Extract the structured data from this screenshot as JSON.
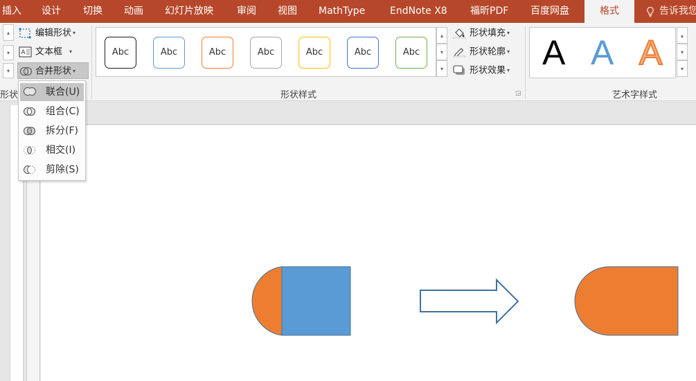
{
  "tabs": [
    {
      "label": "插入",
      "active": false
    },
    {
      "label": "设计",
      "active": false
    },
    {
      "label": "切换",
      "active": false
    },
    {
      "label": "动画",
      "active": false
    },
    {
      "label": "幻灯片放映",
      "active": false
    },
    {
      "label": "审阅",
      "active": false
    },
    {
      "label": "视图",
      "active": false
    },
    {
      "label": "MathType",
      "active": false
    },
    {
      "label": "EndNote X8",
      "active": false
    },
    {
      "label": "福昕PDF",
      "active": false
    },
    {
      "label": "百度网盘",
      "active": false
    },
    {
      "label": "格式",
      "active": true
    }
  ],
  "tell_me": {
    "label": "告诉我您",
    "icon": "lightbulb-icon"
  },
  "ribbon": {
    "insert_shapes": {
      "edit_shape": "编辑形状",
      "text_box": "文本框",
      "merge_shapes": "合并形状",
      "group_label_partial": "形状"
    },
    "shape_styles": {
      "group_label": "形状样式",
      "gallery": [
        {
          "text": "Abc",
          "border": "#1a1a1a"
        },
        {
          "text": "Abc",
          "border": "#5b9bd5"
        },
        {
          "text": "Abc",
          "border": "#ed7d31"
        },
        {
          "text": "Abc",
          "border": "#a5a5a5"
        },
        {
          "text": "Abc",
          "border": "#ffc000"
        },
        {
          "text": "Abc",
          "border": "#4472c4"
        },
        {
          "text": "Abc",
          "border": "#70ad47"
        }
      ],
      "fill": "形状填充",
      "outline": "形状轮廓",
      "effects": "形状效果"
    },
    "wordart": {
      "group_label": "艺术字样式",
      "samples": [
        {
          "text": "A",
          "style": "black"
        },
        {
          "text": "A",
          "style": "blue-gradient"
        },
        {
          "text": "A",
          "style": "orange-outline"
        }
      ]
    }
  },
  "merge_menu": {
    "items": [
      {
        "label": "联合(U)",
        "icon": "union-icon",
        "highlighted": true
      },
      {
        "label": "组合(C)",
        "icon": "combine-icon",
        "highlighted": false
      },
      {
        "label": "拆分(F)",
        "icon": "fragment-icon",
        "highlighted": false
      },
      {
        "label": "相交(I)",
        "icon": "intersect-icon",
        "highlighted": false
      },
      {
        "label": "剪除(S)",
        "icon": "subtract-icon",
        "highlighted": false
      }
    ]
  },
  "colors": {
    "tab_bar": "#b7472a",
    "shape_blue": "#5b9bd5",
    "shape_orange": "#ed7d31",
    "arrow_stroke": "#41719c"
  },
  "slide": {
    "shapes": [
      {
        "name": "half-circle-orange",
        "fill": "#ed7d31"
      },
      {
        "name": "rectangle-blue",
        "fill": "#5b9bd5"
      },
      {
        "name": "right-arrow",
        "fill": "#ffffff"
      },
      {
        "name": "merged-rounded-shape",
        "fill": "#ed7d31"
      }
    ]
  }
}
